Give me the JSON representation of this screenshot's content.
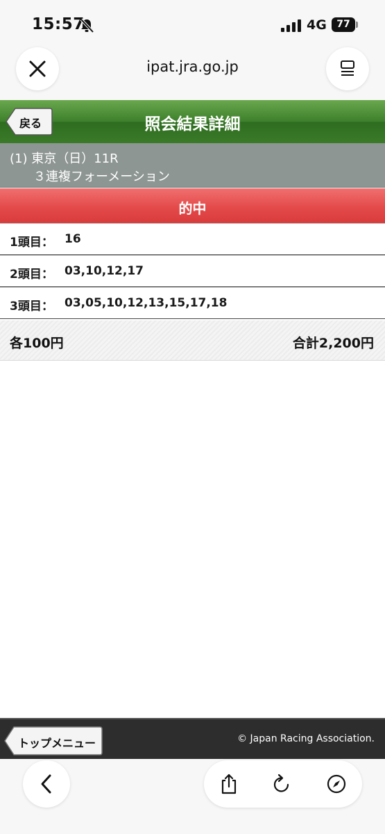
{
  "status_bar": {
    "time": "15:57",
    "network": "4G",
    "battery": "77"
  },
  "browser": {
    "url": "ipat.jra.go.jp"
  },
  "header": {
    "back_label": "戻る",
    "title": "照会結果詳細"
  },
  "race": {
    "line1": "(1) 東京（日）11R",
    "bet_type": "３連複フォーメーション"
  },
  "result": {
    "label": "的中"
  },
  "rows": [
    {
      "label": "1頭目：",
      "value": "16"
    },
    {
      "label": "2頭目：",
      "value": "03,10,12,17"
    },
    {
      "label": "3頭目：",
      "value": "03,05,10,12,13,15,17,18"
    }
  ],
  "summary": {
    "unit_amount": "各100円",
    "total": "合計2,200円"
  },
  "footer": {
    "top_menu_label": "トップメニュー",
    "copyright": "© Japan Racing Association."
  },
  "colors": {
    "header_green": "#3d7f2b",
    "race_gray": "#8d9692",
    "hit_red": "#e44a4a",
    "footer_dark": "#2d2d2d"
  }
}
